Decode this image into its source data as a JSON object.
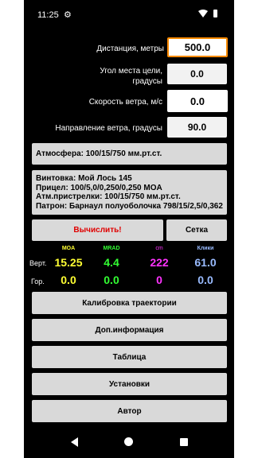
{
  "status_bar": {
    "time": "11:25"
  },
  "fields": {
    "distance": {
      "label": "Дистанция, метры",
      "value": "500.0"
    },
    "angle": {
      "label_line1": "Угол места цели,",
      "label_line2": "градусы",
      "value": "0.0"
    },
    "wind_speed": {
      "label": "Скорость ветра, м/с",
      "value": "0.0"
    },
    "wind_dir": {
      "label": "Направление ветра, градусы",
      "value": "90.0"
    }
  },
  "atmosphere": "Атмосфера: 100/15/750 мм.рт.ст.",
  "info": {
    "rifle": "Винтовка: Мой Лось 145",
    "scope": "Прицел: 100/5,0/0,250/0,250 MOA",
    "zero_atm": "Атм.пристрелки: 100/15/750 мм.рт.ст.",
    "cartridge": "Патрон: Барнаул полуоболочка 798/15/2,5/0,362"
  },
  "buttons": {
    "calculate": "Вычислить!",
    "grid": "Сетка",
    "calibration": "Калибровка траектории",
    "extra_info": "Доп.информация",
    "table": "Таблица",
    "settings": "Установки",
    "author": "Автор"
  },
  "results": {
    "headers": {
      "moa": "MOA",
      "mrad": "MRAD",
      "cm": "cm",
      "clicks": "Клики"
    },
    "row_labels": {
      "vertical": "Верт.",
      "horizontal": "Гор."
    },
    "vertical": {
      "moa": "15.25",
      "mrad": "4.4",
      "cm": "222",
      "clicks": "61.0"
    },
    "horizontal": {
      "moa": "0.0",
      "mrad": "0.0",
      "cm": "0",
      "clicks": "0.0"
    },
    "colors": {
      "moa": "#ffff33",
      "mrad": "#33ff33",
      "cm": "#ff33ff",
      "clicks": "#99bbff"
    }
  },
  "icons": {
    "status_settings": "gear-icon",
    "wifi": "wifi-icon",
    "battery": "battery-icon",
    "nav_back": "back-triangle-icon",
    "nav_home": "home-circle-icon",
    "nav_recents": "recents-square-icon"
  }
}
